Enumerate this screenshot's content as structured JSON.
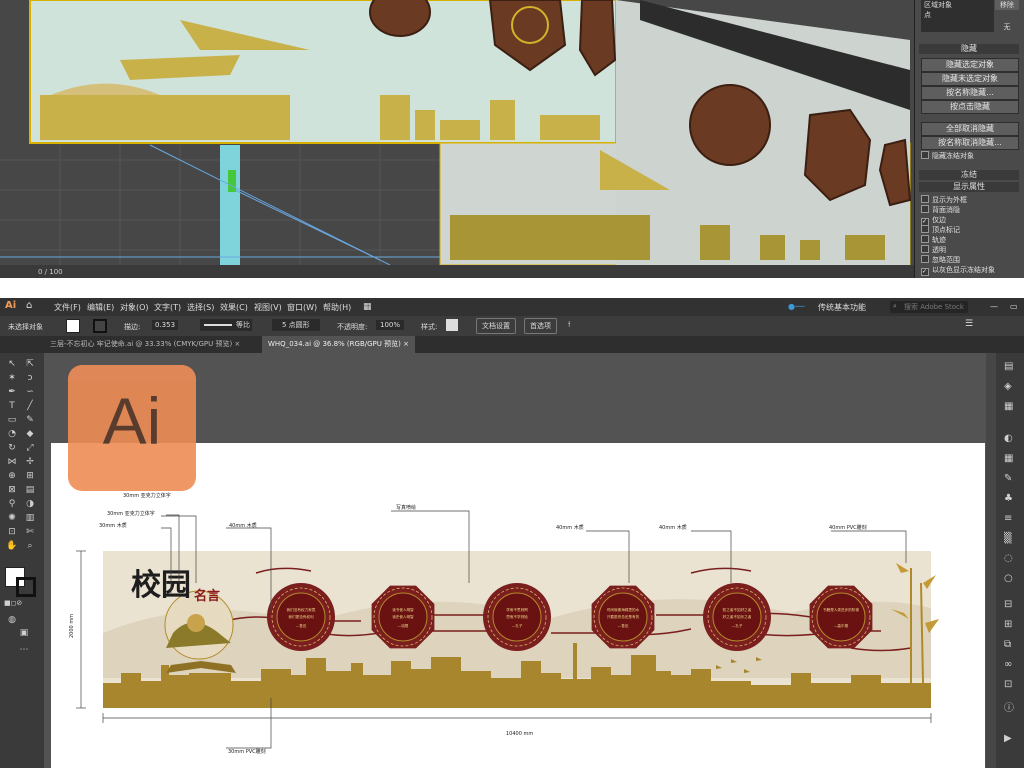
{
  "max": {
    "panel": {
      "top_field": "区域对象",
      "top_field2": "点",
      "side_btn": "移除",
      "side_value": "无",
      "hide_header": "隐藏",
      "hide_buttons": [
        "隐藏选定对象",
        "隐藏未选定对象",
        "按名称隐藏...",
        "按点击隐藏"
      ],
      "unhide_buttons": [
        "全部取消隐藏",
        "按名称取消隐藏..."
      ],
      "hide_frozen": "隐藏冻结对象",
      "freeze_header": "冻结",
      "display_props_header": "显示属性",
      "display_props": [
        "显示为外框",
        "背面消隐",
        "仅边",
        "顶点标记",
        "轨迹",
        "透明",
        "忽略范围",
        "以灰色显示冻结对象"
      ],
      "display_props_checked": [
        false,
        false,
        true,
        false,
        false,
        false,
        false,
        true
      ]
    },
    "timeline": "0 / 100"
  },
  "ai": {
    "app_icon": "Ai",
    "menus": [
      "文件(F)",
      "编辑(E)",
      "对象(O)",
      "文字(T)",
      "选择(S)",
      "效果(C)",
      "视图(V)",
      "窗口(W)",
      "帮助(H)"
    ],
    "workspace": "传统基本功能",
    "search_placeholder": "搜索 Adobe Stock",
    "control": {
      "selection": "未选择对象",
      "stroke_label": "描边:",
      "stroke_value": "0.353",
      "stroke_style": "等比",
      "brush": "5 点圆形",
      "opacity_label": "不透明度:",
      "opacity_value": "100%",
      "style_label": "样式:",
      "doc_setup": "文档设置",
      "prefs": "首选项"
    },
    "tabs": [
      {
        "label": "三层-不忘初心 牢记使命.ai @ 33.33% (CMYK/GPU 预览)",
        "active": false
      },
      {
        "label": "WHQ_034.ai @ 36.8% (RGB/GPU 预览)",
        "active": true
      }
    ],
    "logo_text": "Ai"
  },
  "design": {
    "title_main": "校园",
    "title_sub": "名言",
    "annotations": {
      "a1": "30mm 亚克力立体字",
      "a2": "30mm 亚克力立体字",
      "a3": "30mm 木质",
      "a4": "40mm 木质",
      "a5": "写真喷绘",
      "a6": "40mm 木质",
      "a7": "40mm 木质",
      "a8": "40mm PVC雕刻",
      "a9": "30mm PVC雕刻"
    },
    "height_dim": "2000 mm",
    "width_dim": "10400 mm",
    "plaques": [
      {
        "shape": "circle",
        "text1": "我们没有权力寂寞",
        "text2": "我们更没有权利",
        "author": "—鲁迅"
      },
      {
        "shape": "octagon",
        "text1": "读书使人明智",
        "text2": "读史使人明智",
        "author": "—培根"
      },
      {
        "shape": "circle",
        "text1": "学而不思则罔",
        "text2": "思而不学则殆",
        "author": "—孔子"
      },
      {
        "shape": "octagon",
        "text1": "时间就像海绵里的水",
        "text2": "只要愿挤总还是有的",
        "author": "—鲁迅"
      },
      {
        "shape": "circle",
        "text1": "知之者不如好之者",
        "text2": "好之者不如乐之者",
        "author": "—孔子"
      },
      {
        "shape": "octagon",
        "text1": "书籍是人类进步的阶梯",
        "text2": "",
        "author": "—高尔基"
      }
    ]
  },
  "colors": {
    "maroon": "#7a1e1e",
    "gold": "#b48a2c",
    "olive": "#8a7a2a",
    "beige": "#ebe3d2"
  }
}
